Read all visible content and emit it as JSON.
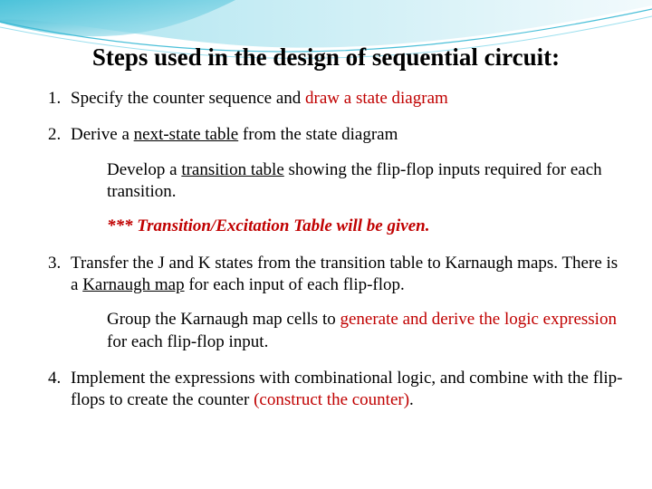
{
  "title": "Steps used in the design of sequential circuit:",
  "step1": {
    "a": "Specify the counter sequence and ",
    "b": "draw a state diagram"
  },
  "step2": {
    "a": "Derive a ",
    "b": "next-state table",
    "c": " from the state diagram",
    "sub1a": "Develop a ",
    "sub1b": "transition table",
    "sub1c": " showing the flip-flop inputs required for each transition.",
    "sub2": "*** Transition/Excitation Table will be given."
  },
  "step3": {
    "a": "Transfer the J and K states from the transition table to Karnaugh maps. There is a ",
    "b": "Karnaugh map",
    "c": " for each input of each flip-flop.",
    "sub1a": "Group the Karnaugh map cells to ",
    "sub1b": "generate and derive the logic expression",
    "sub1c": " for each flip-flop input."
  },
  "step4": {
    "a": "Implement the expressions with combinational logic, and combine with the flip-flops to create the counter ",
    "b": "(construct the counter)",
    "c": "."
  }
}
